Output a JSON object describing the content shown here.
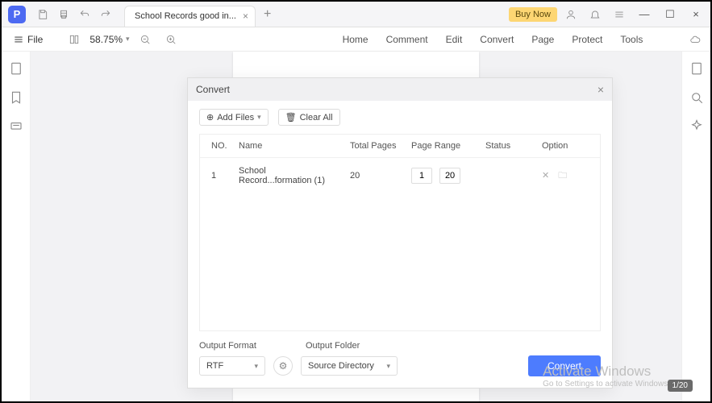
{
  "titlebar": {
    "tab_title": "School Records good in...",
    "buy_now": "Buy Now"
  },
  "toolbar": {
    "file": "File",
    "zoom": "58.75%",
    "menus": [
      "Home",
      "Comment",
      "Edit",
      "Convert",
      "Page",
      "Protect",
      "Tools"
    ]
  },
  "dialog": {
    "title": "Convert",
    "add_files": "Add Files",
    "clear_all": "Clear All",
    "headers": {
      "no": "NO.",
      "name": "Name",
      "total": "Total Pages",
      "range": "Page Range",
      "status": "Status",
      "option": "Option"
    },
    "rows": [
      {
        "no": "1",
        "name": "School Record...formation (1)",
        "total": "20",
        "from": "1",
        "to": "20",
        "status": ""
      }
    ],
    "output_format_label": "Output Format",
    "output_folder_label": "Output Folder",
    "format_value": "RTF",
    "folder_value": "Source Directory",
    "convert_btn": "Convert"
  },
  "watermark": {
    "line1": "Activate Windows",
    "line2": "Go to Settings to activate Windows."
  },
  "page_indicator": "1/20"
}
